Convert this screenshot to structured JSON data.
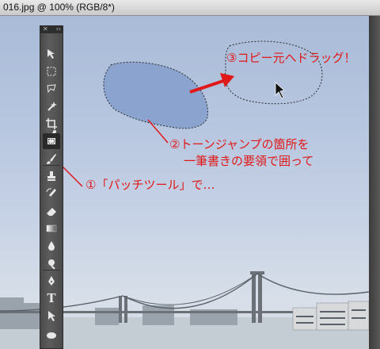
{
  "window": {
    "title": "016.jpg @ 100% (RGB/8*)"
  },
  "palette": {
    "close_glyph": "✕",
    "expand_glyph": "››",
    "tools": [
      {
        "name": "move-tool-icon"
      },
      {
        "name": "marquee-tool-icon"
      },
      {
        "name": "lasso-tool-icon"
      },
      {
        "name": "magic-wand-tool-icon"
      },
      {
        "name": "crop-tool-icon"
      },
      {
        "name": "eyedropper-tool-icon"
      },
      {
        "name": "patch-tool-icon"
      },
      {
        "name": "brush-tool-icon"
      },
      {
        "name": "clone-stamp-tool-icon"
      },
      {
        "name": "history-brush-tool-icon"
      },
      {
        "name": "eraser-tool-icon"
      },
      {
        "name": "gradient-tool-icon"
      },
      {
        "name": "blur-tool-icon"
      },
      {
        "name": "dodge-tool-icon"
      },
      {
        "name": "pen-tool-icon"
      },
      {
        "name": "type-tool-icon"
      },
      {
        "name": "path-selection-tool-icon"
      },
      {
        "name": "ellipse-tool-icon"
      }
    ],
    "type_glyph": "T"
  },
  "annotations": {
    "step1": "①「パッチツール」で…",
    "step2_line1": "②トーンジャンプの箇所を",
    "step2_line2": "一筆書きの要領で囲って",
    "step3": "③コピー元へドラッグ！"
  },
  "colors": {
    "annotation": "#e01818",
    "selection_fill": "#7f9bc8"
  }
}
